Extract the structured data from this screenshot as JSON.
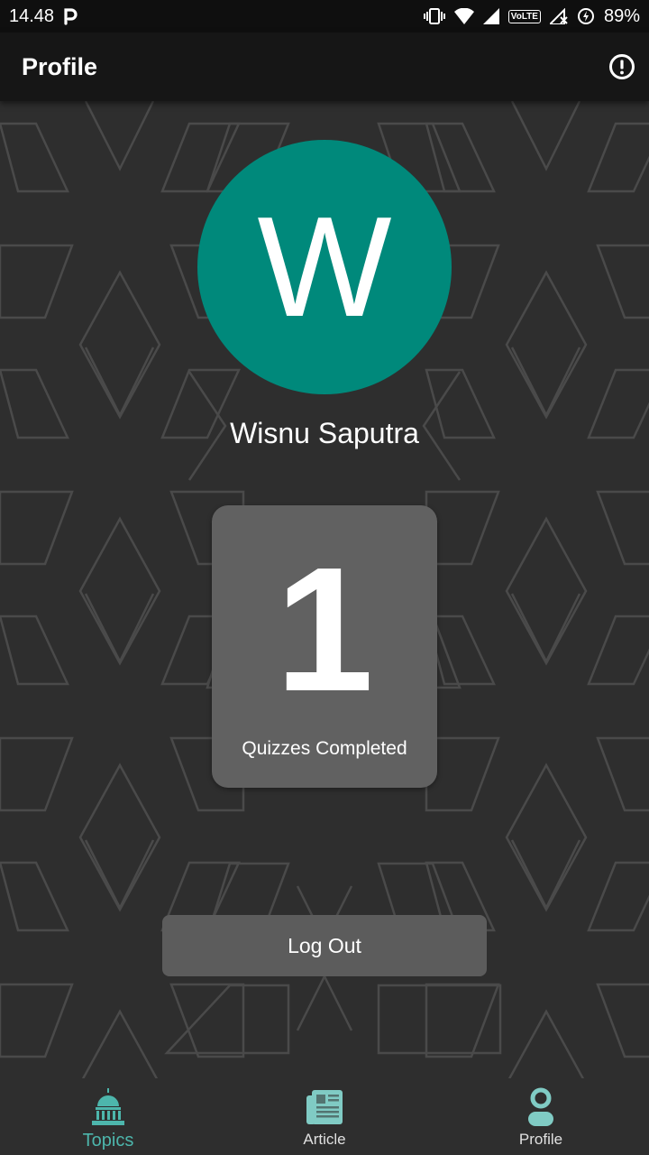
{
  "status_bar": {
    "time": "14.48",
    "carrier_icon": "p-icon",
    "volte": "VoLTE",
    "battery": "89%"
  },
  "app_bar": {
    "title": "Profile",
    "info_icon": "info-circle-icon"
  },
  "profile": {
    "avatar_letter": "W",
    "name": "Wisnu Saputra",
    "avatar_color": "#00897b"
  },
  "stats": {
    "quizzes_completed": "1",
    "label": "Quizzes Completed"
  },
  "actions": {
    "logout_label": "Log Out"
  },
  "bottom_nav": {
    "items": [
      {
        "label": "Topics",
        "icon": "capitol-building-icon",
        "active": true
      },
      {
        "label": "Article",
        "icon": "newspaper-icon",
        "active": false
      },
      {
        "label": "Profile",
        "icon": "person-icon",
        "active": false
      }
    ]
  },
  "colors": {
    "accent": "#4db6ac",
    "background": "#2e2e2e",
    "app_bar": "#161616",
    "card": "#616161"
  }
}
